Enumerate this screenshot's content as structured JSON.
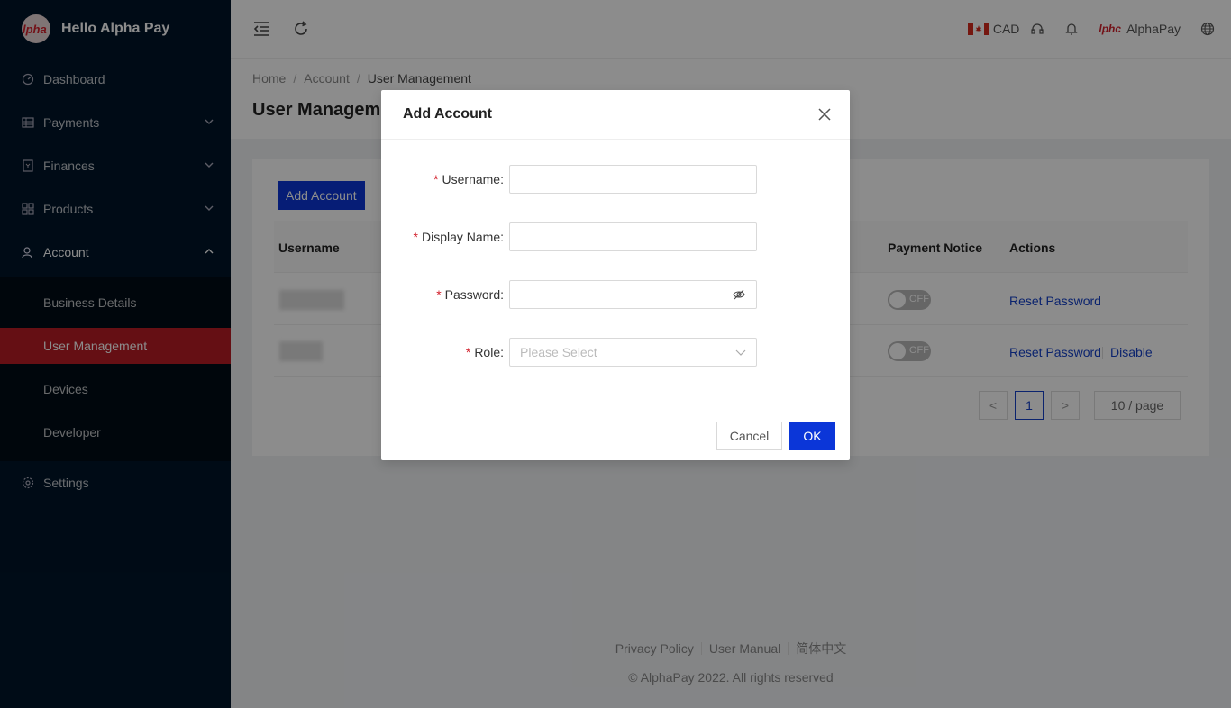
{
  "brand": {
    "logo_text": "lpha",
    "title": "Hello Alpha Pay"
  },
  "sidebar": {
    "items": [
      {
        "label": "Dashboard",
        "icon": "dashboard-icon"
      },
      {
        "label": "Payments",
        "icon": "table-icon"
      },
      {
        "label": "Finances",
        "icon": "receipt-icon"
      },
      {
        "label": "Products",
        "icon": "grid-icon"
      },
      {
        "label": "Account",
        "icon": "user-icon"
      },
      {
        "label": "Settings",
        "icon": "gear-icon"
      }
    ],
    "account_sub": [
      {
        "label": "Business Details"
      },
      {
        "label": "User Management"
      },
      {
        "label": "Devices"
      },
      {
        "label": "Developer"
      }
    ]
  },
  "header": {
    "currency": "CAD",
    "user_logo_text": "lphc",
    "user_name": "AlphaPay"
  },
  "breadcrumb": {
    "home": "Home",
    "account": "Account",
    "current": "User Management",
    "separator": "/"
  },
  "page_title": "User Management",
  "card": {
    "add_button": "Add Account",
    "columns": {
      "username": "Username",
      "payment_notice": "Payment Notice",
      "actions": "Actions"
    },
    "rows": [
      {
        "switch_label": "OFF",
        "actions": [
          "Reset Password"
        ]
      },
      {
        "switch_label": "OFF",
        "actions": [
          "Reset Password",
          "Disable"
        ]
      }
    ],
    "pagination": {
      "prev": "<",
      "page": "1",
      "next": ">",
      "page_size": "10 / page"
    }
  },
  "footer": {
    "links": [
      "Privacy Policy",
      "User Manual",
      "简体中文"
    ],
    "copyright": "© AlphaPay 2022. All rights reserved"
  },
  "modal": {
    "title": "Add Account",
    "fields": {
      "username": {
        "label": "Username",
        "value": ""
      },
      "display_name": {
        "label": "Display Name",
        "value": ""
      },
      "password": {
        "label": "Password",
        "value": ""
      },
      "role": {
        "label": "Role",
        "placeholder": "Please Select"
      }
    },
    "required_mark": "*",
    "colon": ":",
    "cancel": "Cancel",
    "ok": "OK"
  },
  "colors": {
    "sidebar_bg": "#001529",
    "active_menu": "#b81c25",
    "primary": "#0b36d8",
    "link": "#1440c8"
  }
}
